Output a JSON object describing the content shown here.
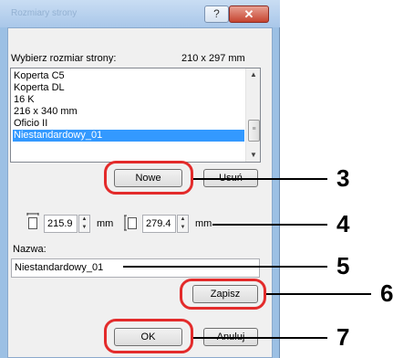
{
  "window": {
    "title": "Rozmiary strony",
    "help_button": "?",
    "close_button": "✕"
  },
  "page_size": {
    "label": "Wybierz rozmiar strony:",
    "current_size": "210 x 297 mm",
    "items": [
      {
        "label": "Koperta C5"
      },
      {
        "label": "Koperta DL"
      },
      {
        "label": "16 K"
      },
      {
        "label": "216 x 340 mm"
      },
      {
        "label": "Oficio II"
      },
      {
        "label": "Niestandardowy_01",
        "selected": true
      }
    ]
  },
  "buttons": {
    "new_label": "Nowe",
    "delete_label": "Usuń",
    "save_label": "Zapisz",
    "ok_label": "OK",
    "cancel_label": "Anuluj"
  },
  "dimensions": {
    "width_value": "215.9",
    "width_unit": "mm",
    "height_value": "279.4",
    "height_unit": "mm"
  },
  "name": {
    "label": "Nazwa:",
    "value": "Niestandardowy_01"
  },
  "callouts": [
    "3",
    "4",
    "5",
    "6",
    "7"
  ],
  "colors": {
    "highlight": "#e32b2b",
    "selection": "#3399ff"
  }
}
